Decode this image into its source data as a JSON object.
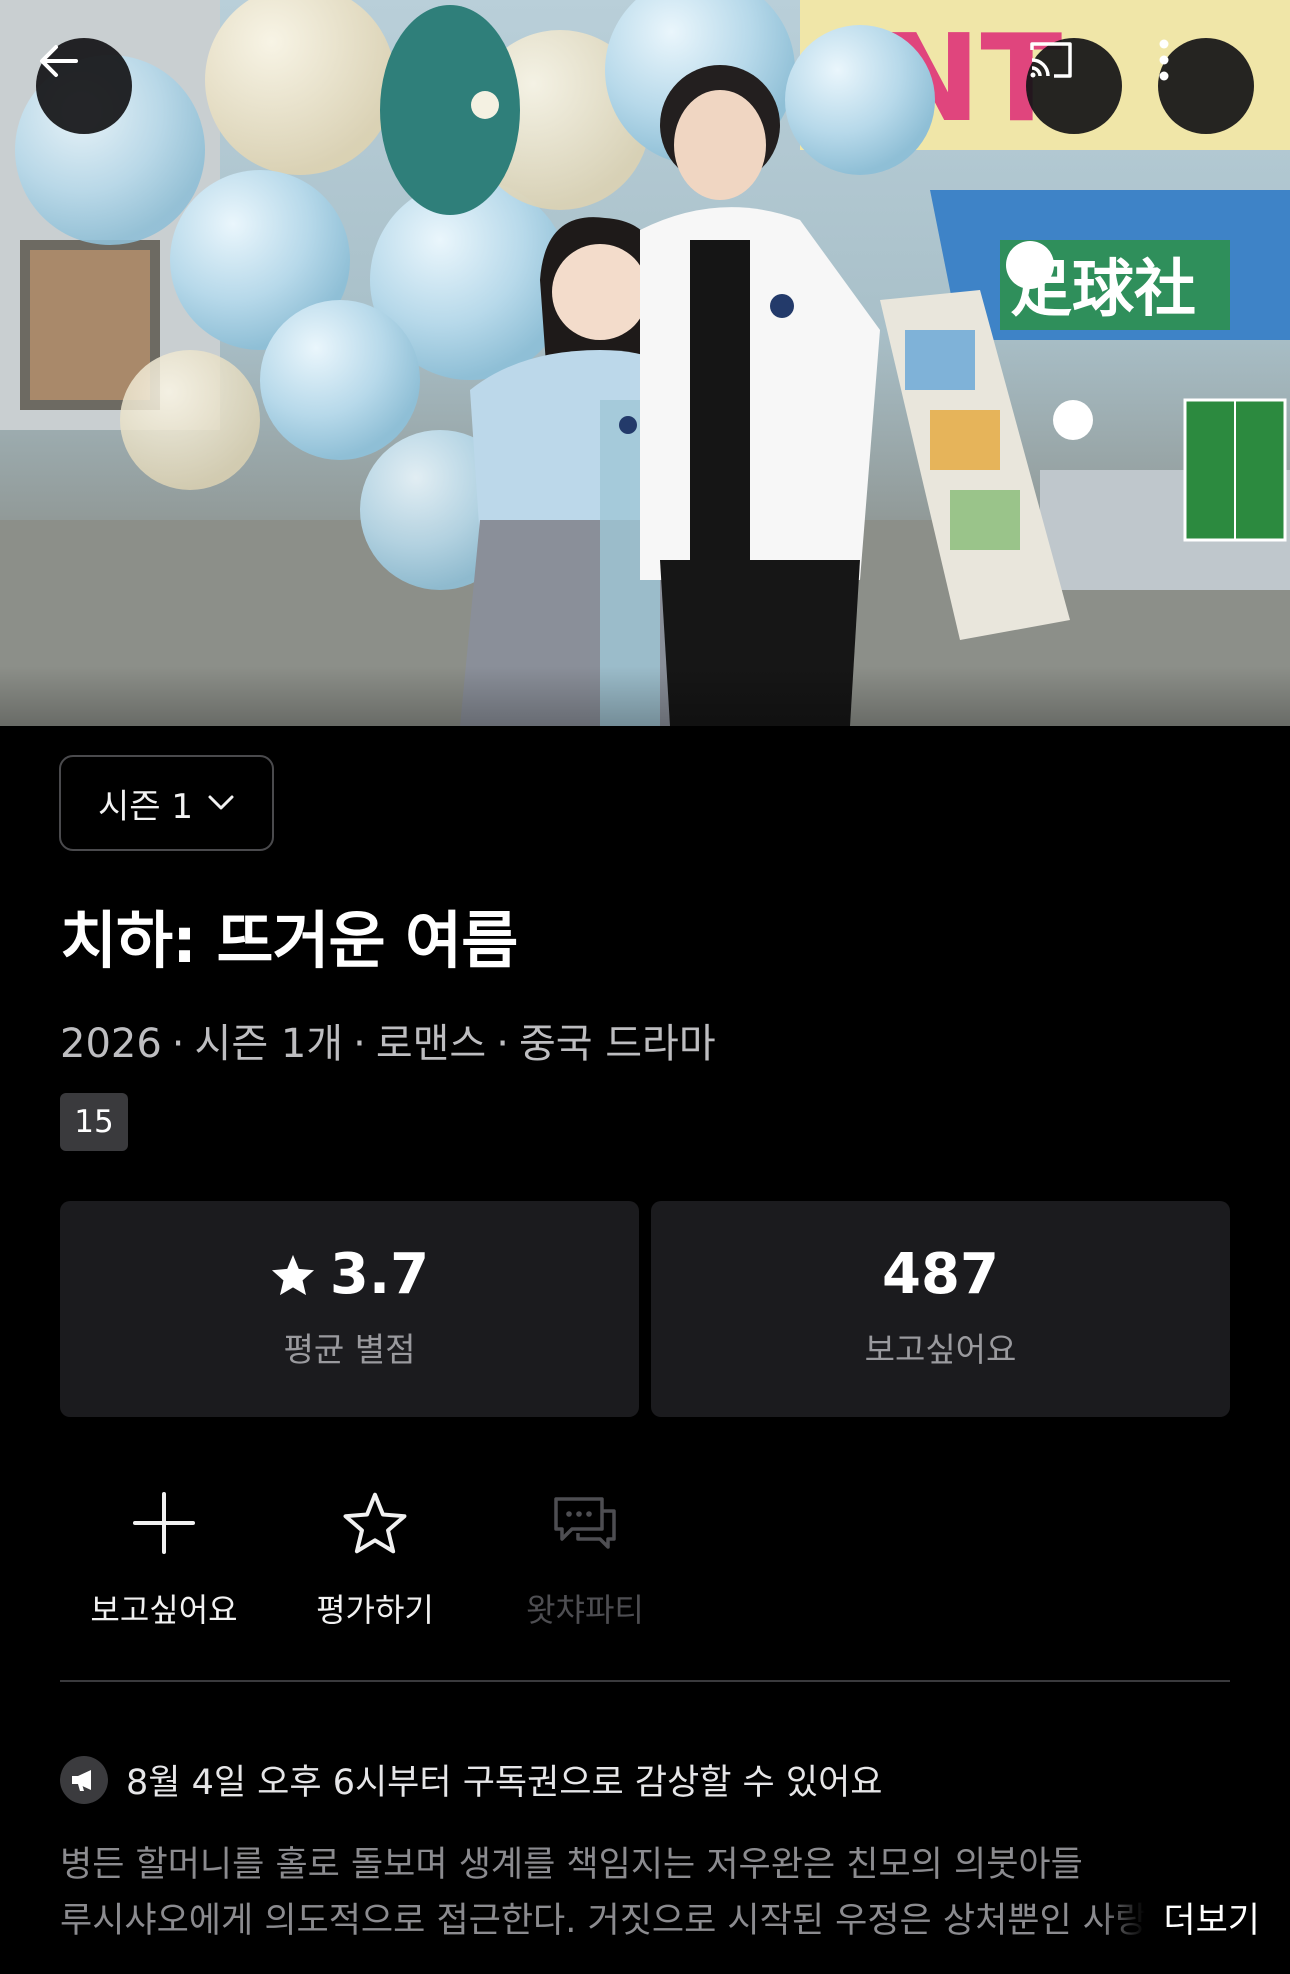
{
  "header": {
    "back_icon": "arrow-left-icon",
    "cast_icon": "cast-icon",
    "more_icon": "more-vertical-icon"
  },
  "poster": {
    "sign_text": "足球社"
  },
  "season_selector": {
    "label": "시즌 1",
    "icon": "chevron-down-icon"
  },
  "title": "치하: 뜨거운 여름",
  "meta": {
    "year": "2026",
    "seasons": "시즌 1개",
    "genre": "로맨스",
    "category": "중국 드라마",
    "separator": "·"
  },
  "age_rating": "15",
  "stats": {
    "rating_value": "3.7",
    "rating_label": "평균 별점",
    "wishlist_count": "487",
    "wishlist_label": "보고싶어요"
  },
  "actions": [
    {
      "label": "보고싶어요",
      "icon": "plus-icon",
      "enabled": true
    },
    {
      "label": "평가하기",
      "icon": "star-outline-icon",
      "enabled": true
    },
    {
      "label": "왓챠파티",
      "icon": "chat-bubble-icon",
      "enabled": false
    }
  ],
  "notice": {
    "icon": "megaphone-icon",
    "text": "8월 4일 오후 6시부터 구독권으로 감상할 수 있어요"
  },
  "synopsis": {
    "line1": "병든 할머니를 홀로 돌보며 생계를 책임지는 저우완은 친모의 의붓아들",
    "line2": "루시샤오에게 의도적으로 접근한다. 거짓으로 시작된 우정은 상처뿐인 사랑",
    "more_label": "더보기"
  },
  "colors": {
    "background": "#000000",
    "card": "#1b1b1e",
    "muted_text": "#9a9a9e"
  }
}
